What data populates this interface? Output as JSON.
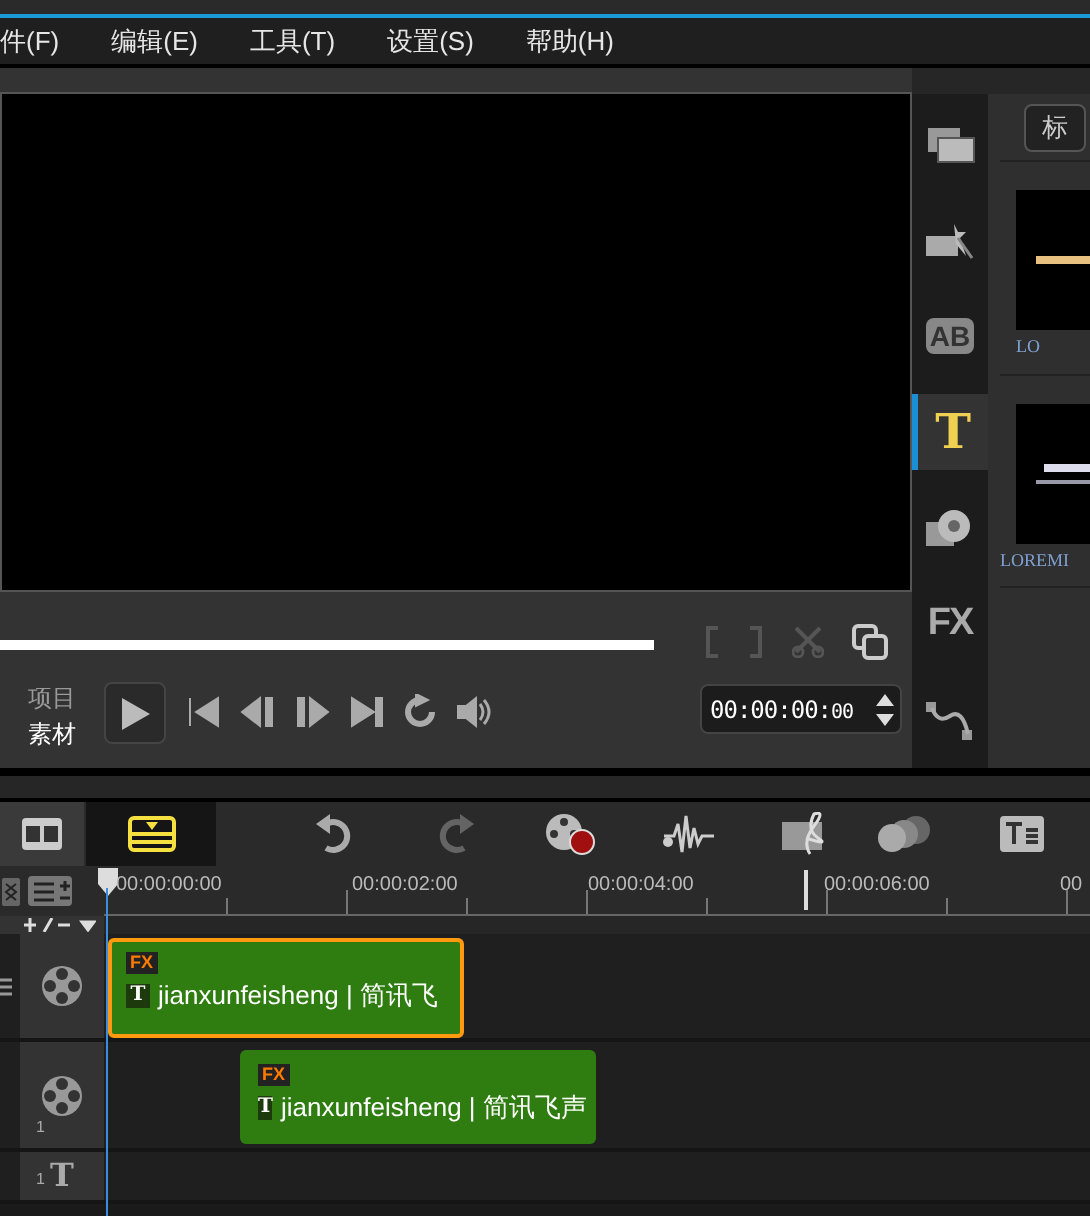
{
  "menu": [
    {
      "label": "件(F)"
    },
    {
      "label": "编辑(E)"
    },
    {
      "label": "工具(T)"
    },
    {
      "label": "设置(S)"
    },
    {
      "label": "帮助(H)"
    }
  ],
  "preview": {
    "mode_options": [
      {
        "label": "项目",
        "selected": false
      },
      {
        "label": "素材",
        "selected": true
      }
    ],
    "timecode": "00:00:00:",
    "timecode_frames": "00"
  },
  "library": {
    "sidebar": [
      {
        "kind": "media",
        "selected": false
      },
      {
        "kind": "instant",
        "selected": false
      },
      {
        "kind": "transition",
        "label": "AB",
        "selected": false
      },
      {
        "kind": "title",
        "label": "T",
        "selected": true
      },
      {
        "kind": "graphic",
        "selected": false
      },
      {
        "kind": "filter",
        "label": "FX",
        "selected": false
      },
      {
        "kind": "path",
        "selected": false
      }
    ],
    "tab_button": "标",
    "thumbnails": [
      {
        "caption": "LO"
      },
      {
        "caption": "LOREMI"
      }
    ]
  },
  "timeline": {
    "toolbar": [
      {
        "kind": "storyboard",
        "selected": false
      },
      {
        "kind": "timeline",
        "selected": true
      },
      {
        "kind": "undo",
        "disabled": false
      },
      {
        "kind": "redo",
        "disabled": true
      },
      {
        "kind": "record"
      },
      {
        "kind": "audio"
      },
      {
        "kind": "music"
      },
      {
        "kind": "mix"
      },
      {
        "kind": "subtitle"
      }
    ],
    "ruler": [
      "00:00:00:00",
      "00:00:02:00",
      "00:00:04:00",
      "00:00:06:00",
      "00"
    ],
    "tracks": [
      {
        "kind": "video",
        "clips": [
          {
            "fx": "FX",
            "icon": "T",
            "text": "jianxunfeisheng | 简讯飞",
            "selected": true
          }
        ]
      },
      {
        "kind": "overlay",
        "number": "1",
        "clips": [
          {
            "fx": "FX",
            "icon": "T",
            "text": "jianxunfeisheng | 简讯飞声",
            "selected": false
          }
        ]
      },
      {
        "kind": "title",
        "number": "1",
        "icon": "T"
      }
    ]
  }
}
